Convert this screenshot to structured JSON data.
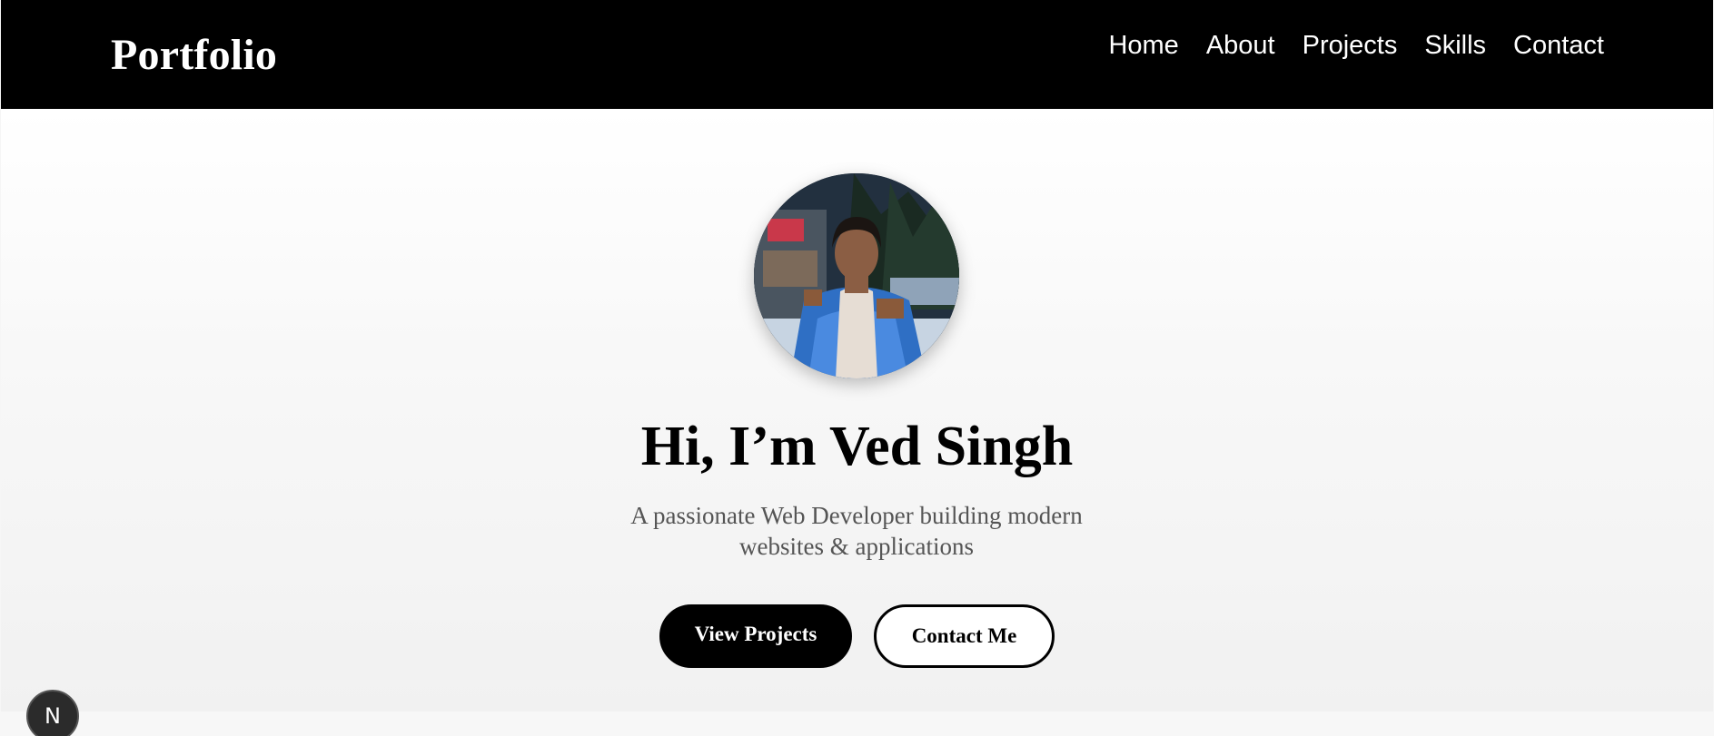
{
  "navbar": {
    "brand": "Portfolio",
    "links": [
      {
        "label": "Home"
      },
      {
        "label": "About"
      },
      {
        "label": "Projects"
      },
      {
        "label": "Skills"
      },
      {
        "label": "Contact"
      }
    ]
  },
  "hero": {
    "avatar_icon": "profile-photo",
    "title": "Hi, I’m Ved Singh",
    "subtitle": "A passionate Web Developer building modern websites & applications",
    "primary_button": "View Projects",
    "secondary_button": "Contact Me"
  },
  "dev_badge": {
    "label": "N",
    "icon": "nextjs-icon"
  },
  "colors": {
    "navbar_bg": "#000000",
    "navbar_text": "#ffffff",
    "primary_button_bg": "#000000",
    "subtitle_text": "#555555",
    "hero_bg": "#f6f6f6"
  }
}
